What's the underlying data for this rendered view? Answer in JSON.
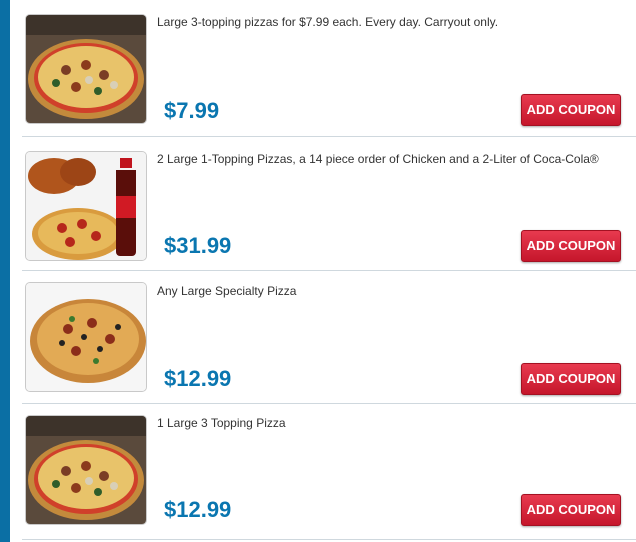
{
  "coupons": [
    {
      "description": "Large 3-topping pizzas for $7.99 each. Every day. Carryout only.",
      "price": "$7.99",
      "button_label": "ADD COUPON",
      "image": "pizza-on-board-icon"
    },
    {
      "description": "2 Large 1-Topping Pizzas, a 14 piece order of Chicken and a 2-Liter of Coca-Cola®",
      "price": "$31.99",
      "button_label": "ADD COUPON",
      "image": "pizza-chicken-soda-icon"
    },
    {
      "description": "Any Large Specialty Pizza",
      "price": "$12.99",
      "button_label": "ADD COUPON",
      "image": "specialty-pizza-icon"
    },
    {
      "description": "1 Large 3 Topping Pizza",
      "price": "$12.99",
      "button_label": "ADD COUPON",
      "image": "pizza-on-board-icon"
    }
  ],
  "colors": {
    "accent_rule": "#0b6fa4",
    "price": "#0a76b0",
    "button": "#d72a3e"
  }
}
